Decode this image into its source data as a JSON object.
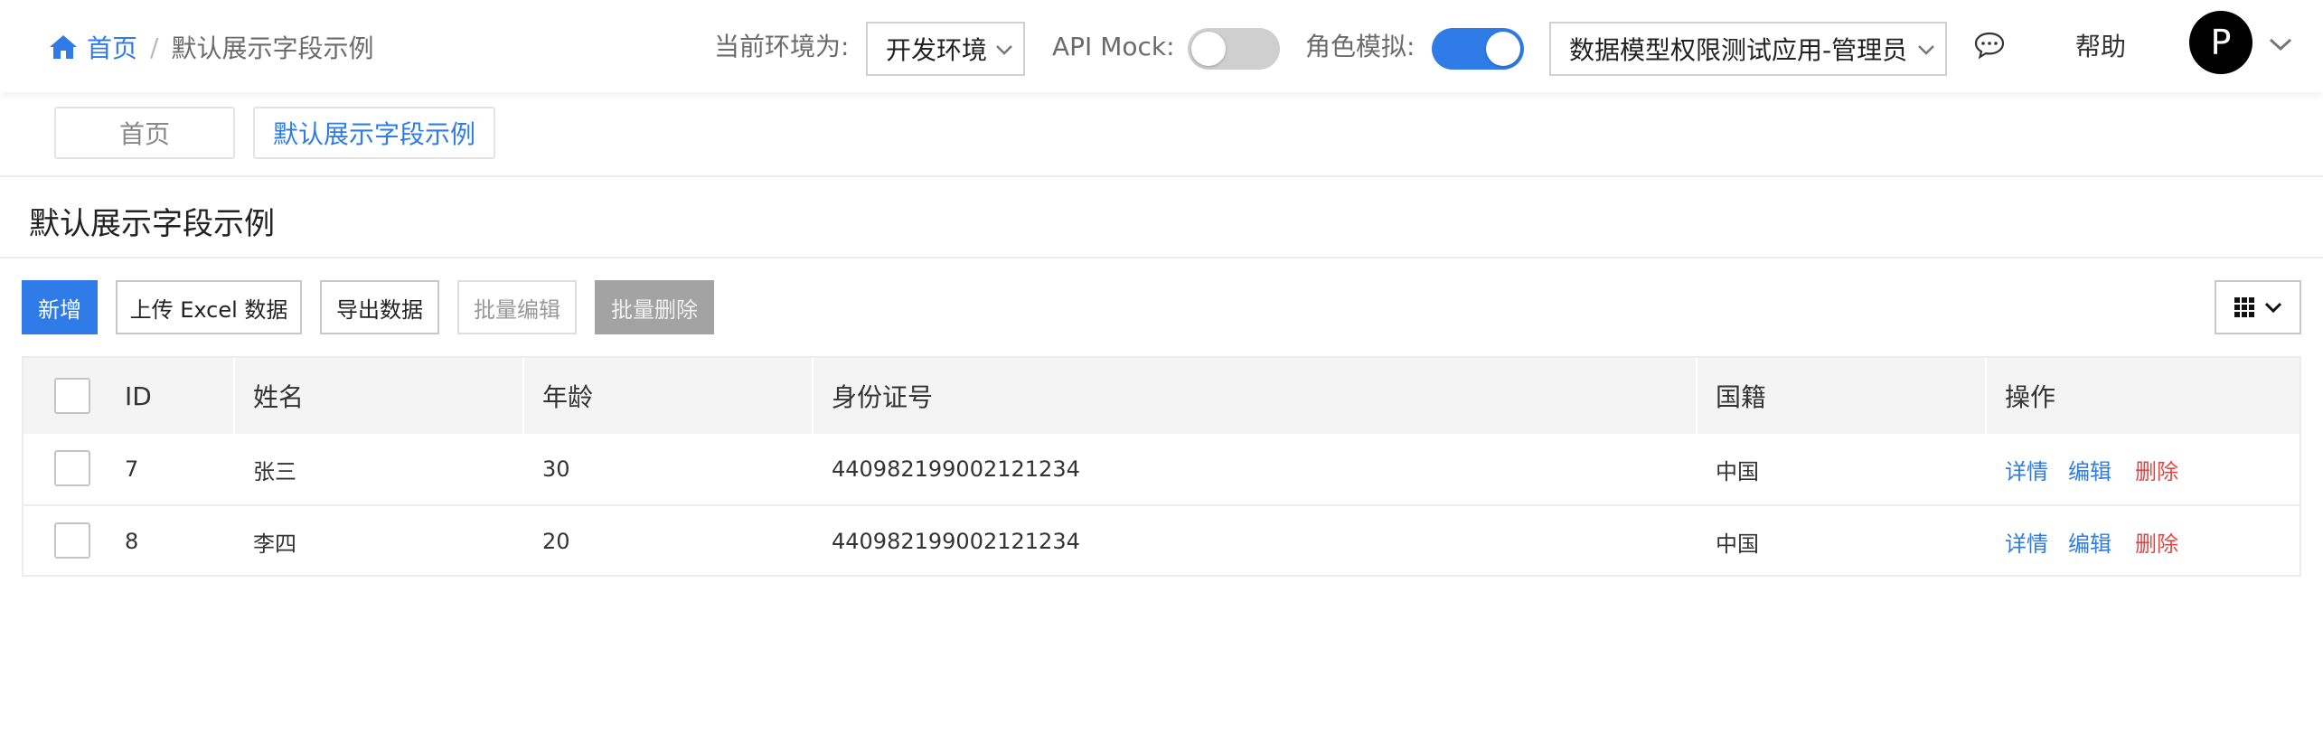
{
  "header": {
    "breadcrumb_home": "首页",
    "breadcrumb_sep": "/",
    "breadcrumb_current": "默认展示字段示例",
    "env_label": "当前环境为:",
    "env_value": "开发环境",
    "api_mock_label": "API Mock:",
    "api_mock_on": false,
    "role_label": "角色模拟:",
    "role_on": true,
    "app_role_value": "数据模型权限测试应用-管理员",
    "help_label": "帮助",
    "avatar_letter": "P"
  },
  "tabs": [
    {
      "label": "首页",
      "active": false
    },
    {
      "label": "默认展示字段示例",
      "active": true
    }
  ],
  "page": {
    "title": "默认展示字段示例"
  },
  "toolbar": {
    "new_label": "新增",
    "upload_label": "上传 Excel 数据",
    "export_label": "导出数据",
    "batch_edit_label": "批量编辑",
    "batch_delete_label": "批量删除"
  },
  "table": {
    "columns": [
      "ID",
      "姓名",
      "年龄",
      "身份证号",
      "国籍",
      "操作"
    ],
    "rows": [
      {
        "id": "7",
        "name": "张三",
        "age": "30",
        "id_number": "440982199002121234",
        "nationality": "中国"
      },
      {
        "id": "8",
        "name": "李四",
        "age": "20",
        "id_number": "440982199002121234",
        "nationality": "中国"
      }
    ],
    "actions": {
      "detail": "详情",
      "edit": "编辑",
      "delete": "删除"
    }
  },
  "colors": {
    "accent": "#2f7ce8",
    "danger": "#e04848",
    "header_bg": "#f4f4f4"
  },
  "icons": [
    "home-icon",
    "chevron-down-icon",
    "message-icon",
    "grid-icon"
  ]
}
